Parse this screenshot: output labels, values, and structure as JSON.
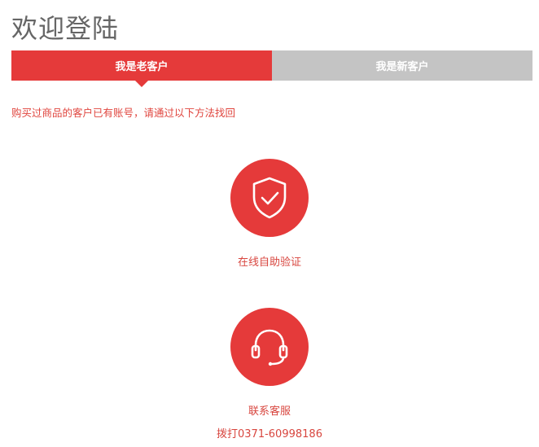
{
  "page": {
    "title": "欢迎登陆"
  },
  "tabs": [
    {
      "label": "我是老客户",
      "active": true
    },
    {
      "label": "我是新客户",
      "active": false
    }
  ],
  "hint": "购买过商品的客户已有账号，请通过以下方法找回",
  "options": {
    "verify": {
      "label": "在线自助验证",
      "icon": "shield-check-icon"
    },
    "service": {
      "label": "联系客服",
      "phone": "拨打0371-60998186",
      "icon": "headset-icon"
    }
  },
  "colors": {
    "accent": "#e53a3a",
    "inactive_tab": "#c4c4c4",
    "title": "#666666"
  }
}
